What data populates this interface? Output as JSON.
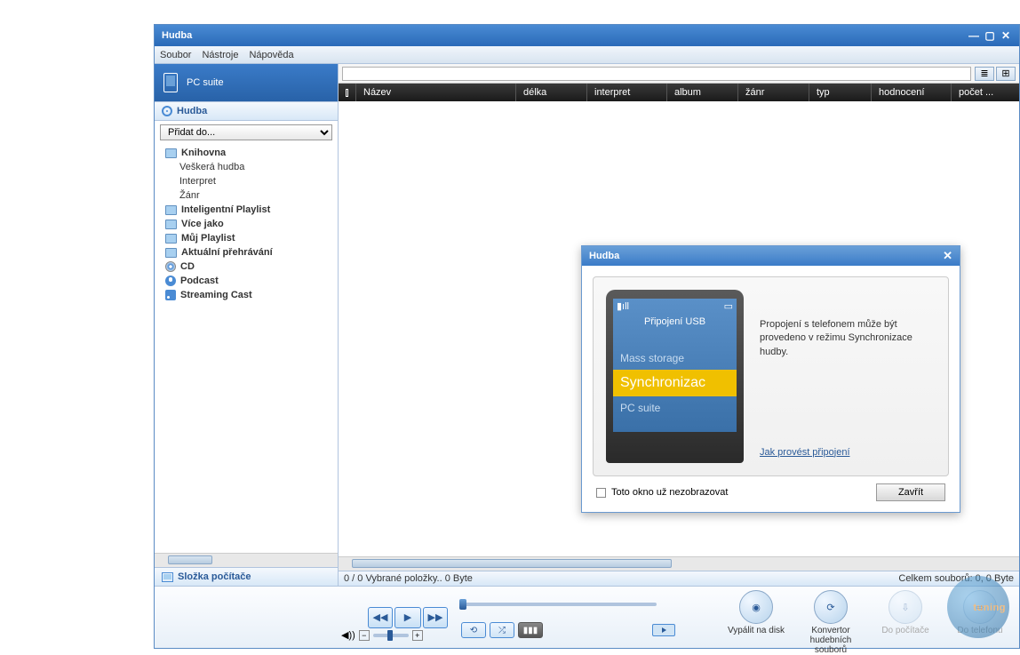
{
  "window": {
    "title": "Hudba"
  },
  "menu": {
    "file": "Soubor",
    "tools": "Nástroje",
    "help": "Nápověda"
  },
  "pc_suite": "PC suite",
  "sidebar": {
    "hudba": "Hudba",
    "dropdown": "Přidat do...",
    "items": {
      "knihovna": "Knihovna",
      "veskera": "Veškerá hudba",
      "interpret": "Interpret",
      "zanr": "Žánr",
      "intel": "Inteligentní Playlist",
      "vice": "Více jako",
      "muj": "Můj Playlist",
      "aktualni": "Aktuální přehrávání",
      "cd": "CD",
      "podcast": "Podcast",
      "streaming": "Streaming Cast"
    },
    "footer": "Složka počítače"
  },
  "columns": {
    "nazev": "Název",
    "delka": "délka",
    "interpret": "interpret",
    "album": "album",
    "zanr": "žánr",
    "typ": "typ",
    "hodnoceni": "hodnocení",
    "pocet": "počet ..."
  },
  "status": {
    "left": "0 / 0 Vybrané položky.. 0 Byte",
    "right": "Celkem souborů: 0, 0 Byte"
  },
  "actions": {
    "burn": "Vypálit na disk",
    "convert": "Konvertor hudebních souborů",
    "topc": "Do počítače",
    "tophone": "Do telefonu"
  },
  "dialog": {
    "title": "Hudba",
    "phone_header": "Připojení USB",
    "mass": "Mass storage",
    "sync": "Synchronizac",
    "pcsuite": "PC suite",
    "message": "Propojení s telefonem může být provedeno v režimu Synchronizace hudby.",
    "link": "Jak provést připojení",
    "dont_show": "Toto okno už nezobrazovat",
    "close": "Zavřít"
  },
  "watermark": "tuning"
}
